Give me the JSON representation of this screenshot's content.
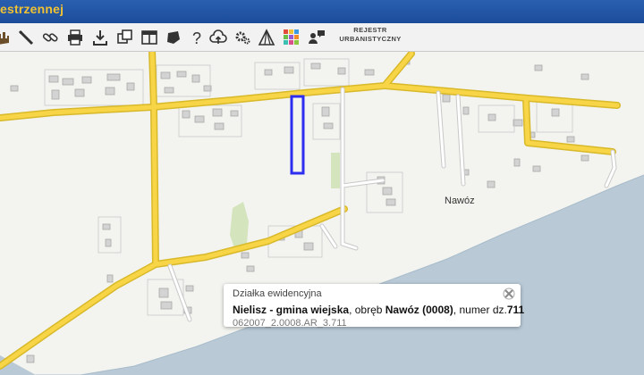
{
  "header": {
    "title": "estrzennej"
  },
  "toolbar": {
    "buttons": [
      {
        "icon": "hand-icon"
      },
      {
        "icon": "ruler-icon"
      },
      {
        "icon": "link-icon"
      },
      {
        "icon": "printer-icon"
      },
      {
        "icon": "download-icon"
      },
      {
        "icon": "copy-icon"
      },
      {
        "icon": "layout-icon"
      },
      {
        "icon": "area-shape-icon"
      },
      {
        "icon": "help-icon"
      },
      {
        "icon": "cloud-upload-icon"
      },
      {
        "icon": "settings-icon"
      },
      {
        "icon": "terrain-icon"
      },
      {
        "icon": "color-grid-icon"
      },
      {
        "icon": "chat-user-icon"
      }
    ],
    "registry_line1": "REJESTR",
    "registry_line2": "URBANISTYCZNY"
  },
  "map": {
    "town_label": "Nawóz",
    "colors": {
      "road": "#f7d547",
      "water": "#b9c9d6",
      "parcel_highlight": "#2d2df0",
      "buildings": "#c2c2c2"
    }
  },
  "popup": {
    "title": "Działka ewidencyjna",
    "place": "Nielisz - gmina wiejska",
    "precinct_prefix": ", obręb ",
    "precinct": "Nawóz (0008)",
    "number_prefix": ", numer dz.",
    "number": "711",
    "sub": "062007_2.0008.AR_3.711"
  }
}
